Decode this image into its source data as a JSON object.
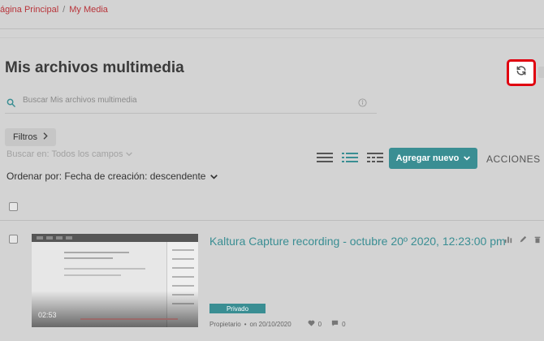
{
  "breadcrumb": {
    "home": "ágina Principal",
    "separator": "/",
    "current": "My Media"
  },
  "page": {
    "title": "Mis archivos multimedia"
  },
  "search": {
    "placeholder": "Buscar Mis archivos multimedia"
  },
  "filters": {
    "label": "Filtros",
    "search_in": "Buscar en: Todos los campos"
  },
  "sort": {
    "label": "Ordenar por: Fecha de creación: descendente"
  },
  "toolbar": {
    "add_new": "Agregar nuevo",
    "actions": "ACCIONES"
  },
  "entries": [
    {
      "title": "Kaltura Capture recording - octubre 20º 2020, 12:23:00 pm",
      "duration": "02:53",
      "status": "Privado",
      "owner": "Propietario",
      "date": "on 20/10/2020",
      "likes": "0",
      "comments": "0"
    }
  ],
  "colors": {
    "accent": "#3a8e93",
    "breadcrumb": "#b8343a",
    "highlight": "#e0000f"
  },
  "icons": [
    "refresh-icon",
    "search-icon",
    "info-icon",
    "chevron-right-icon",
    "chevron-down-icon",
    "list-view-icon",
    "detailed-view-icon",
    "table-view-icon",
    "stats-icon",
    "edit-icon",
    "delete-icon",
    "heart-icon",
    "comment-icon"
  ]
}
